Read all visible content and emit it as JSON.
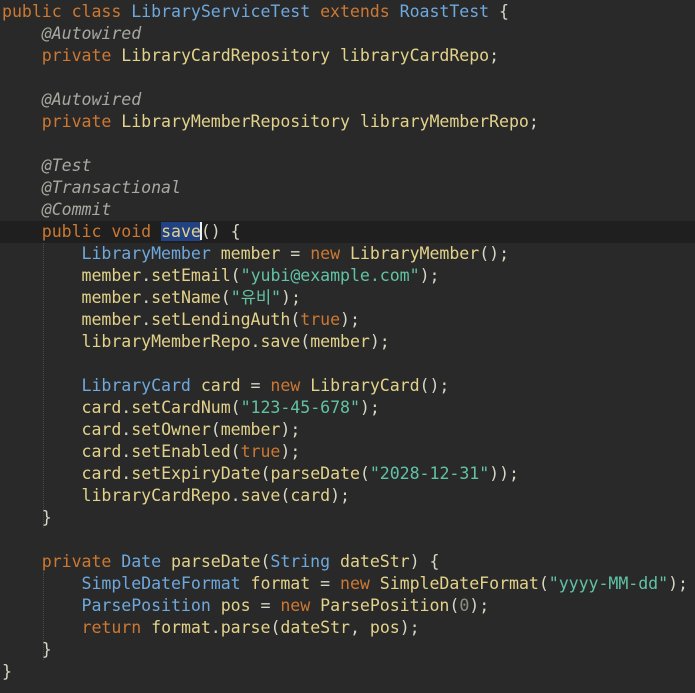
{
  "editor": {
    "theme": "dark",
    "background": "#292929",
    "current_line_background": "#1f1f1f",
    "selection_background": "#214283",
    "selected_word": "save",
    "lines": [
      [
        [
          "kw",
          "public class "
        ],
        [
          "ty",
          "LibraryServiceTest "
        ],
        [
          "kw",
          "extends "
        ],
        [
          "ty",
          "RoastTest "
        ],
        [
          "pl",
          "{"
        ]
      ],
      [
        [
          "pl",
          "    "
        ],
        [
          "an",
          "@Autowired"
        ]
      ],
      [
        [
          "pl",
          "    "
        ],
        [
          "kw",
          "private "
        ],
        [
          "fn",
          "LibraryCardRepository "
        ],
        [
          "vr",
          "libraryCardRepo"
        ],
        [
          "pl",
          ";"
        ]
      ],
      [],
      [
        [
          "pl",
          "    "
        ],
        [
          "an",
          "@Autowired"
        ]
      ],
      [
        [
          "pl",
          "    "
        ],
        [
          "kw",
          "private "
        ],
        [
          "fn",
          "LibraryMemberRepository "
        ],
        [
          "vr",
          "libraryMemberRepo"
        ],
        [
          "pl",
          ";"
        ]
      ],
      [],
      [
        [
          "pl",
          "    "
        ],
        [
          "an",
          "@Test"
        ]
      ],
      [
        [
          "pl",
          "    "
        ],
        [
          "an",
          "@Transactional"
        ]
      ],
      [
        [
          "pl",
          "    "
        ],
        [
          "an",
          "@Commit"
        ]
      ],
      [
        [
          "pl",
          "    "
        ],
        [
          "kw",
          "public void "
        ],
        [
          "sel",
          "save"
        ],
        [
          "caret",
          ""
        ],
        [
          "pl",
          "() {"
        ]
      ],
      [
        [
          "pl",
          "        "
        ],
        [
          "ty",
          "LibraryMember "
        ],
        [
          "vr",
          "member "
        ],
        [
          "pl",
          "= "
        ],
        [
          "kw",
          "new "
        ],
        [
          "fn",
          "LibraryMember"
        ],
        [
          "pl",
          "();"
        ]
      ],
      [
        [
          "pl",
          "        "
        ],
        [
          "vr",
          "member"
        ],
        [
          "pl",
          "."
        ],
        [
          "fn",
          "setEmail"
        ],
        [
          "pl",
          "("
        ],
        [
          "st",
          "\"yubi@example.com\""
        ],
        [
          "pl",
          ");"
        ]
      ],
      [
        [
          "pl",
          "        "
        ],
        [
          "vr",
          "member"
        ],
        [
          "pl",
          "."
        ],
        [
          "fn",
          "setName"
        ],
        [
          "pl",
          "("
        ],
        [
          "st",
          "\"유비\""
        ],
        [
          "pl",
          ");"
        ]
      ],
      [
        [
          "pl",
          "        "
        ],
        [
          "vr",
          "member"
        ],
        [
          "pl",
          "."
        ],
        [
          "fn",
          "setLendingAuth"
        ],
        [
          "pl",
          "("
        ],
        [
          "kw",
          "true"
        ],
        [
          "pl",
          ");"
        ]
      ],
      [
        [
          "pl",
          "        "
        ],
        [
          "vr",
          "libraryMemberRepo"
        ],
        [
          "pl",
          "."
        ],
        [
          "fn",
          "save"
        ],
        [
          "pl",
          "("
        ],
        [
          "vr",
          "member"
        ],
        [
          "pl",
          ");"
        ]
      ],
      [],
      [
        [
          "pl",
          "        "
        ],
        [
          "ty",
          "LibraryCard "
        ],
        [
          "vr",
          "card "
        ],
        [
          "pl",
          "= "
        ],
        [
          "kw",
          "new "
        ],
        [
          "fn",
          "LibraryCard"
        ],
        [
          "pl",
          "();"
        ]
      ],
      [
        [
          "pl",
          "        "
        ],
        [
          "vr",
          "card"
        ],
        [
          "pl",
          "."
        ],
        [
          "fn",
          "setCardNum"
        ],
        [
          "pl",
          "("
        ],
        [
          "st",
          "\"123-45-678\""
        ],
        [
          "pl",
          ");"
        ]
      ],
      [
        [
          "pl",
          "        "
        ],
        [
          "vr",
          "card"
        ],
        [
          "pl",
          "."
        ],
        [
          "fn",
          "setOwner"
        ],
        [
          "pl",
          "("
        ],
        [
          "vr",
          "member"
        ],
        [
          "pl",
          ");"
        ]
      ],
      [
        [
          "pl",
          "        "
        ],
        [
          "vr",
          "card"
        ],
        [
          "pl",
          "."
        ],
        [
          "fn",
          "setEnabled"
        ],
        [
          "pl",
          "("
        ],
        [
          "kw",
          "true"
        ],
        [
          "pl",
          ");"
        ]
      ],
      [
        [
          "pl",
          "        "
        ],
        [
          "vr",
          "card"
        ],
        [
          "pl",
          "."
        ],
        [
          "fn",
          "setExpiryDate"
        ],
        [
          "pl",
          "("
        ],
        [
          "fn",
          "parseDate"
        ],
        [
          "pl",
          "("
        ],
        [
          "st",
          "\"2028-12-31\""
        ],
        [
          "pl",
          "));"
        ]
      ],
      [
        [
          "pl",
          "        "
        ],
        [
          "vr",
          "libraryCardRepo"
        ],
        [
          "pl",
          "."
        ],
        [
          "fn",
          "save"
        ],
        [
          "pl",
          "("
        ],
        [
          "vr",
          "card"
        ],
        [
          "pl",
          ");"
        ]
      ],
      [
        [
          "pl",
          "    }"
        ]
      ],
      [],
      [
        [
          "pl",
          "    "
        ],
        [
          "kw",
          "private "
        ],
        [
          "ty",
          "Date "
        ],
        [
          "fn",
          "parseDate"
        ],
        [
          "pl",
          "("
        ],
        [
          "ty",
          "String "
        ],
        [
          "vr",
          "dateStr"
        ],
        [
          "pl",
          ") {"
        ]
      ],
      [
        [
          "pl",
          "        "
        ],
        [
          "ty",
          "SimpleDateFormat "
        ],
        [
          "vr",
          "format "
        ],
        [
          "pl",
          "= "
        ],
        [
          "kw",
          "new "
        ],
        [
          "fn",
          "SimpleDateFormat"
        ],
        [
          "pl",
          "("
        ],
        [
          "st",
          "\"yyyy-MM-dd\""
        ],
        [
          "pl",
          ");"
        ]
      ],
      [
        [
          "pl",
          "        "
        ],
        [
          "ty",
          "ParsePosition "
        ],
        [
          "vr",
          "pos "
        ],
        [
          "pl",
          "= "
        ],
        [
          "kw",
          "new "
        ],
        [
          "fn",
          "ParsePosition"
        ],
        [
          "pl",
          "("
        ],
        [
          "nm",
          "0"
        ],
        [
          "pl",
          ");"
        ]
      ],
      [
        [
          "pl",
          "        "
        ],
        [
          "kw",
          "return "
        ],
        [
          "vr",
          "format"
        ],
        [
          "pl",
          "."
        ],
        [
          "fn",
          "parse"
        ],
        [
          "pl",
          "("
        ],
        [
          "vr",
          "dateStr"
        ],
        [
          "pl",
          ", "
        ],
        [
          "vr",
          "pos"
        ],
        [
          "pl",
          ");"
        ]
      ],
      [
        [
          "pl",
          "    }"
        ]
      ],
      [
        [
          "pl",
          "}"
        ]
      ]
    ],
    "current_line_index": 10
  }
}
